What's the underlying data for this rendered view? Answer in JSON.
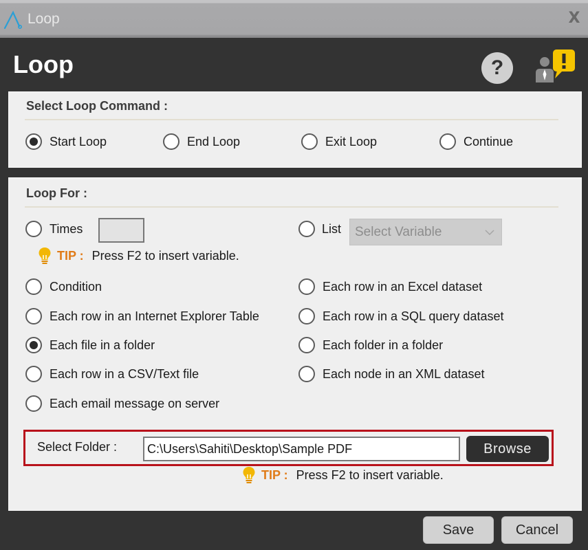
{
  "window": {
    "title": "Loop",
    "close_glyph": "X",
    "logo_icon": "automate-logo-icon"
  },
  "header": {
    "title": "Loop",
    "help_glyph": "?",
    "help_icon": "help-icon",
    "support_icon": "support-agent-alert-icon"
  },
  "loop_command": {
    "label": "Select Loop Command :",
    "options": [
      {
        "label": "Start Loop",
        "checked": true
      },
      {
        "label": "End Loop",
        "checked": false
      },
      {
        "label": "Exit Loop",
        "checked": false
      },
      {
        "label": "Continue",
        "checked": false
      }
    ]
  },
  "loop_for": {
    "label": "Loop For :",
    "times": {
      "label": "Times",
      "value": "",
      "checked": false
    },
    "list": {
      "label": "List",
      "placeholder": "Select Variable",
      "checked": false
    },
    "tip": {
      "label": "TIP :",
      "text": "Press F2 to insert variable."
    },
    "left_options": [
      {
        "label": "Condition",
        "checked": false
      },
      {
        "label": "Each row in an Internet Explorer Table",
        "checked": false
      },
      {
        "label": "Each file in a folder",
        "checked": true
      },
      {
        "label": "Each row in a CSV/Text file",
        "checked": false
      },
      {
        "label": "Each email message on server",
        "checked": false
      }
    ],
    "right_options": [
      {
        "label": "Each row in an Excel dataset",
        "checked": false
      },
      {
        "label": "Each row in a SQL query dataset",
        "checked": false
      },
      {
        "label": "Each folder in a folder",
        "checked": false
      },
      {
        "label": "Each node in an XML dataset",
        "checked": false
      }
    ],
    "select_folder": {
      "label": "Select Folder :",
      "value": "C:\\Users\\Sahiti\\Desktop\\Sample PDF",
      "browse_label": "Browse",
      "highlight_color": "#b8121b"
    },
    "folder_tip": {
      "label": "TIP :",
      "text": "Press F2 to insert variable."
    }
  },
  "footer": {
    "save_label": "Save",
    "cancel_label": "Cancel"
  },
  "colors": {
    "tip_accent": "#e07b18",
    "bulb": "#f2b705",
    "alert_badge": "#f5c400",
    "background": "#333333",
    "panel": "#efefef"
  }
}
